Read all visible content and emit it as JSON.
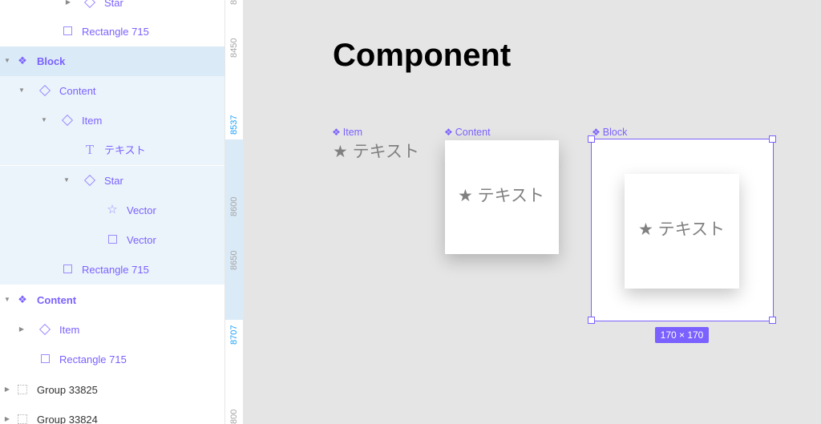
{
  "layers": [
    {
      "label": "Star",
      "icon": "diamond",
      "caret": "right"
    },
    {
      "label": "Rectangle 715",
      "icon": "square",
      "caret": ""
    },
    {
      "label": "Block",
      "icon": "component",
      "caret": "down"
    },
    {
      "label": "Content",
      "icon": "diamond",
      "caret": "down"
    },
    {
      "label": "Item",
      "icon": "diamond",
      "caret": "down"
    },
    {
      "label": "テキスト",
      "icon": "text",
      "caret": ""
    },
    {
      "label": "Star",
      "icon": "diamond",
      "caret": "down"
    },
    {
      "label": "Vector",
      "icon": "star-outline",
      "caret": ""
    },
    {
      "label": "Vector",
      "icon": "square",
      "caret": ""
    },
    {
      "label": "Rectangle 715",
      "icon": "square",
      "caret": ""
    },
    {
      "label": "Content",
      "icon": "component",
      "caret": "down"
    },
    {
      "label": "Item",
      "icon": "diamond",
      "caret": "right"
    },
    {
      "label": "Rectangle 715",
      "icon": "square",
      "caret": ""
    },
    {
      "label": "Group 33825",
      "icon": "group",
      "caret": "right"
    },
    {
      "label": "Group 33824",
      "icon": "group",
      "caret": "right"
    }
  ],
  "ruler": {
    "ticks": [
      "8",
      "8450",
      "8537",
      "8600",
      "8650",
      "8707",
      "800"
    ]
  },
  "canvas": {
    "title": "Component",
    "item_label": "Item",
    "content_label": "Content",
    "block_label": "Block",
    "item_text": "★ テキスト",
    "content_text": "★ テキスト",
    "block_text": "★ テキスト",
    "size_badge": "170 × 170"
  },
  "colors": {
    "accent": "#7b61ff",
    "selection_bg": "#daeaf7",
    "ruler_highlight": "#18a0fb",
    "canvas_bg": "#e5e5e5"
  }
}
